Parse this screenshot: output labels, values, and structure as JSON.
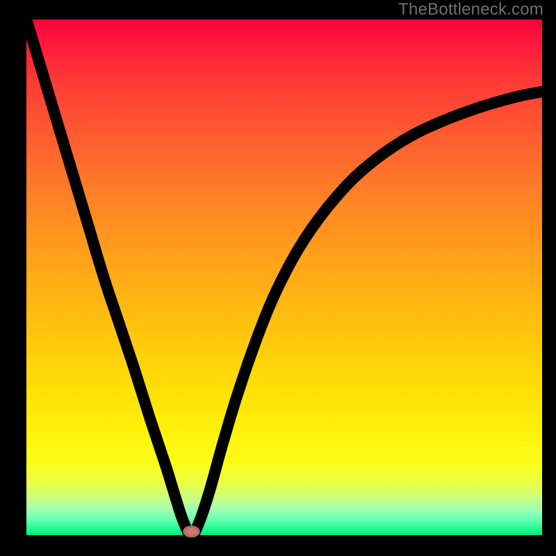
{
  "watermark": "TheBottleneck.com",
  "colors": {
    "background": "#000000",
    "gradient_top": "#ff003b",
    "gradient_bottom": "#07e878",
    "curve": "#000000",
    "marker": "#c97a6a"
  },
  "chart_data": {
    "type": "line",
    "title": "",
    "xlabel": "",
    "ylabel": "",
    "xlim": [
      0,
      100
    ],
    "ylim": [
      0,
      100
    ],
    "minimum": {
      "x": 32,
      "y": 0
    },
    "description": "V-shaped bottleneck curve on a vertical red-to-green gradient. The curve descends steeply and nearly linearly from the top-left corner, reaches a minimum near x≈32 at the bottom axis (marked with a small rounded marker), then rises again as a concave curve toward the upper-right, leveling off as it approaches the right edge.",
    "series": [
      {
        "name": "bottleneck-curve",
        "points": [
          {
            "x": 0.0,
            "y": 100.0
          },
          {
            "x": 3.0,
            "y": 90.0
          },
          {
            "x": 6.0,
            "y": 80.0
          },
          {
            "x": 9.0,
            "y": 70.0
          },
          {
            "x": 12.0,
            "y": 60.0
          },
          {
            "x": 15.0,
            "y": 50.0
          },
          {
            "x": 18.0,
            "y": 41.0
          },
          {
            "x": 21.0,
            "y": 32.0
          },
          {
            "x": 24.0,
            "y": 22.5
          },
          {
            "x": 27.0,
            "y": 13.5
          },
          {
            "x": 29.0,
            "y": 7.0
          },
          {
            "x": 30.5,
            "y": 2.5
          },
          {
            "x": 32.0,
            "y": 0.0
          },
          {
            "x": 33.5,
            "y": 2.5
          },
          {
            "x": 35.5,
            "y": 8.5
          },
          {
            "x": 38.0,
            "y": 17.5
          },
          {
            "x": 41.0,
            "y": 27.5
          },
          {
            "x": 45.0,
            "y": 39.0
          },
          {
            "x": 49.0,
            "y": 48.5
          },
          {
            "x": 54.0,
            "y": 57.5
          },
          {
            "x": 60.0,
            "y": 65.5
          },
          {
            "x": 66.0,
            "y": 71.5
          },
          {
            "x": 73.0,
            "y": 76.5
          },
          {
            "x": 80.0,
            "y": 80.0
          },
          {
            "x": 88.0,
            "y": 83.0
          },
          {
            "x": 95.0,
            "y": 85.0
          },
          {
            "x": 100.0,
            "y": 86.0
          }
        ]
      }
    ]
  }
}
